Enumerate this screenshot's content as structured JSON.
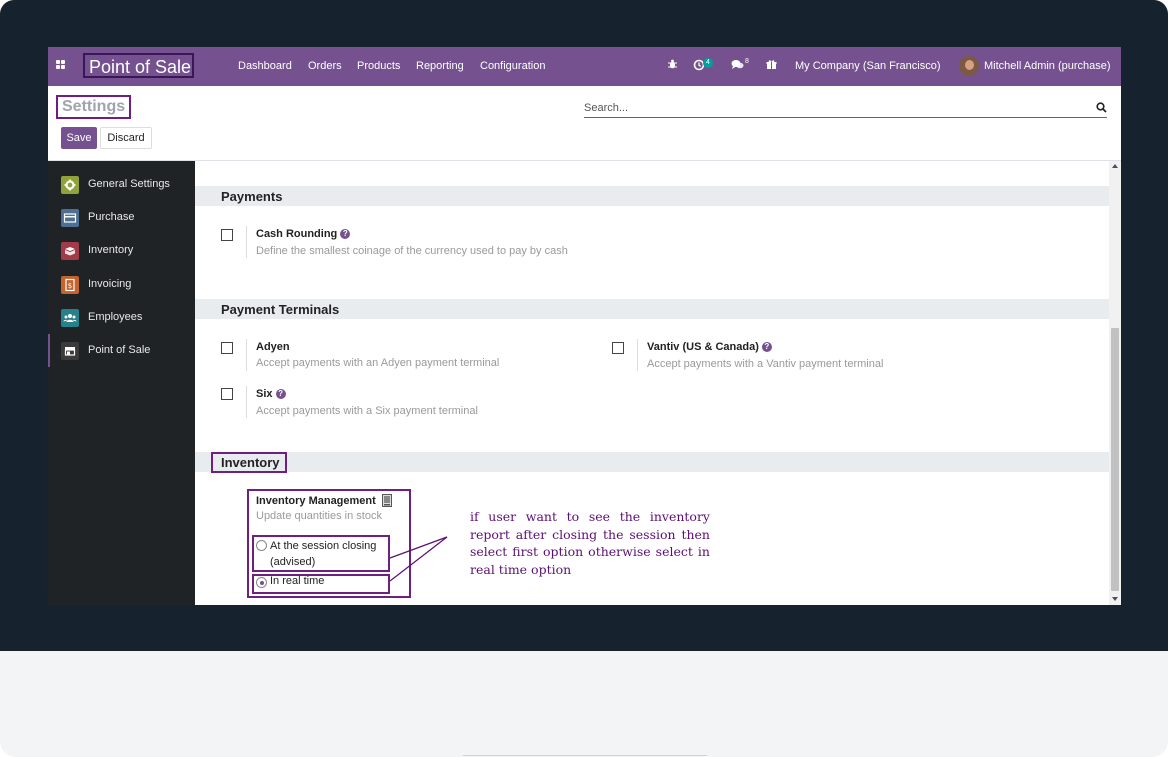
{
  "navbar": {
    "app_title": "Point of Sale",
    "menu": [
      "Dashboard",
      "Orders",
      "Products",
      "Reporting",
      "Configuration"
    ],
    "activity_count": "4",
    "message_count": "8",
    "company": "My Company (San Francisco)",
    "user": "Mitchell Admin (purchase)"
  },
  "control_panel": {
    "title": "Settings",
    "save_label": "Save",
    "discard_label": "Discard",
    "search_placeholder": "Search..."
  },
  "sidebar": {
    "items": [
      {
        "label": "General Settings",
        "color": "#8ea33a"
      },
      {
        "label": "Purchase",
        "color": "#4d6f94"
      },
      {
        "label": "Inventory",
        "color": "#a33a48"
      },
      {
        "label": "Invoicing",
        "color": "#c4632c"
      },
      {
        "label": "Employees",
        "color": "#26828a"
      },
      {
        "label": "Point of Sale",
        "color": "#3b3b3b",
        "active": true
      }
    ]
  },
  "sections": {
    "payments": {
      "title": "Payments",
      "cash_rounding": {
        "title": "Cash Rounding",
        "desc": "Define the smallest coinage of the currency used to pay by cash",
        "checked": false
      }
    },
    "payment_terminals": {
      "title": "Payment Terminals",
      "adyen": {
        "title": "Adyen",
        "desc": "Accept payments with an Adyen payment terminal",
        "checked": false
      },
      "vantiv": {
        "title": "Vantiv (US & Canada)",
        "desc": "Accept payments with a Vantiv payment terminal",
        "checked": false
      },
      "six": {
        "title": "Six",
        "desc": "Accept payments with a Six payment terminal",
        "checked": false
      }
    },
    "inventory": {
      "title": "Inventory",
      "management": {
        "title": "Inventory Management",
        "desc": "Update quantities in stock"
      },
      "options": [
        {
          "label_line1": "At the session closing",
          "label_line2": "(advised)",
          "selected": false
        },
        {
          "label_line1": "In real time",
          "selected": true
        }
      ]
    }
  },
  "annotation": "if user want to see the inventory report after closing the session then select first option otherwise select in real time option",
  "colors": {
    "brand": "#75528f",
    "annotation": "#6e1f7f",
    "bezel": "#17222f"
  }
}
